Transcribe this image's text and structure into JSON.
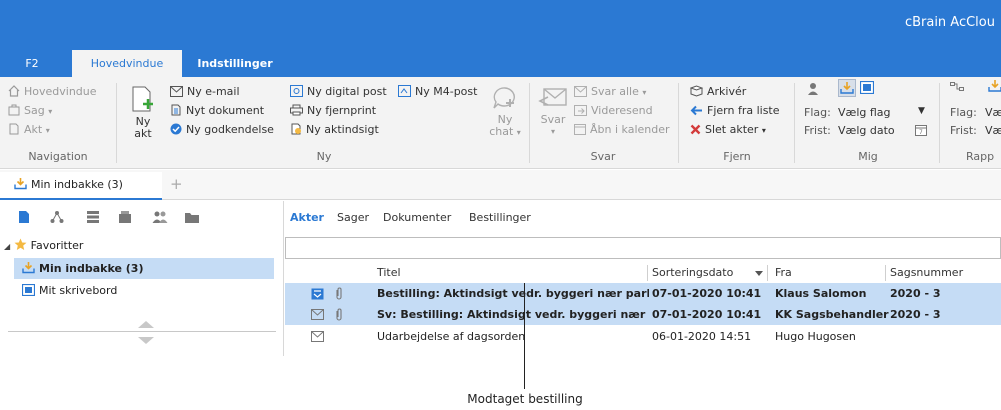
{
  "app": {
    "title": "cBrain AcClou"
  },
  "ribbon_tabs": {
    "f2": "F2",
    "hovedvindue": "Hovedvindue",
    "indstillinger": "Indstillinger"
  },
  "navigation": {
    "hovedvindue": "Hovedvindue",
    "sag": "Sag",
    "akt": "Akt",
    "label": "Navigation"
  },
  "ny": {
    "ny_akt_line1": "Ny",
    "ny_akt_line2": "akt",
    "ny_email": "Ny e-mail",
    "nyt_dokument": "Nyt dokument",
    "ny_godkendelse": "Ny godkendelse",
    "ny_digital_post": "Ny digital post",
    "ny_m4_post": "Ny M4-post",
    "ny_fjernprint": "Ny fjernprint",
    "ny_aktindsigt": "Ny aktindsigt",
    "ny_chat_line1": "Ny",
    "ny_chat_line2": "chat",
    "label": "Ny"
  },
  "svar": {
    "svar": "Svar",
    "svar_alle": "Svar alle",
    "videresend": "Videresend",
    "aabn_i_kalender": "Åbn i kalender",
    "label": "Svar"
  },
  "fjern": {
    "arkiver": "Arkivér",
    "fjern_fra_liste": "Fjern fra liste",
    "slet_akter": "Slet akter",
    "label": "Fjern"
  },
  "mig": {
    "flag_label": "Flag:",
    "flag_value": "Vælg flag",
    "frist_label": "Frist:",
    "frist_value": "Vælg dato",
    "label": "Mig"
  },
  "rapp": {
    "flag_label": "Flag:",
    "flag_value": "Væ",
    "frist_label": "Frist:",
    "frist_value": "Væ",
    "label": "Rapp"
  },
  "doc_tab": {
    "label": "Min indbakke (3)",
    "add": "+"
  },
  "tree": {
    "favoritter": "Favoritter",
    "min_indbakke": "Min indbakke (3)",
    "mit_skrivebord": "Mit skrivebord"
  },
  "subtabs": {
    "akter": "Akter",
    "sager": "Sager",
    "dokumenter": "Dokumenter",
    "bestillinger": "Bestillinger"
  },
  "table": {
    "headers": {
      "titel": "Titel",
      "sorteringsdato": "Sorteringsdato",
      "fra": "Fra",
      "sagsnummer": "Sagsnummer"
    },
    "rows": [
      {
        "titel": "Bestilling: Aktindsigt vedr. byggeri nær parken",
        "dato": "07-01-2020 10:41",
        "fra": "Klaus Salomon",
        "sagsnummer": "2020 - 3",
        "selected": true,
        "bold": true
      },
      {
        "titel": "Sv: Bestilling: Aktindsigt vedr. byggeri nær pa...",
        "dato": "07-01-2020 10:41",
        "fra": "KK Sagsbehandler",
        "sagsnummer": "2020 - 3",
        "selected": true,
        "bold": true
      },
      {
        "titel": "Udarbejdelse af dagsorden",
        "dato": "06-01-2020 14:51",
        "fra": "Hugo Hugosen",
        "sagsnummer": "",
        "selected": false,
        "bold": false
      }
    ]
  },
  "callout": {
    "text": "Modtaget bestilling"
  },
  "colors": {
    "accent": "#2b79d3",
    "selection": "#c5dcf5",
    "ribbon_bg": "#f3f3f3",
    "star": "#f4b942"
  }
}
